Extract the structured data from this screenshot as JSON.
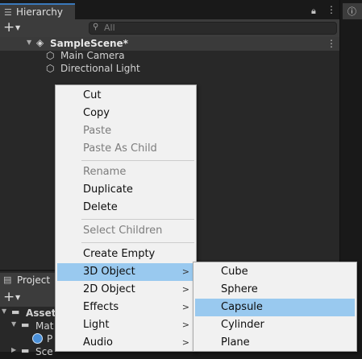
{
  "hierarchy": {
    "tab_icon": "hierarchy-list-icon",
    "tab_label": "Hierarchy",
    "search_placeholder": "All",
    "scene_name": "SampleScene*",
    "objects": [
      "Main Camera",
      "Directional Light"
    ]
  },
  "project": {
    "tab_label": "Project",
    "tree": [
      "Asset",
      "Mat",
      "P",
      "Sce"
    ]
  },
  "context_menu": {
    "items": [
      {
        "label": "Cut",
        "enabled": true
      },
      {
        "label": "Copy",
        "enabled": true
      },
      {
        "label": "Paste",
        "enabled": false
      },
      {
        "label": "Paste As Child",
        "enabled": false
      },
      {
        "label": "Rename",
        "enabled": false
      },
      {
        "label": "Duplicate",
        "enabled": true
      },
      {
        "label": "Delete",
        "enabled": true
      },
      {
        "label": "Select Children",
        "enabled": false
      },
      {
        "label": "Create Empty",
        "enabled": true
      },
      {
        "label": "3D Object",
        "enabled": true,
        "submenu": true,
        "highlighted": true
      },
      {
        "label": "2D Object",
        "enabled": true,
        "submenu": true
      },
      {
        "label": "Effects",
        "enabled": true,
        "submenu": true
      },
      {
        "label": "Light",
        "enabled": true,
        "submenu": true
      },
      {
        "label": "Audio",
        "enabled": true,
        "submenu": true
      }
    ]
  },
  "submenu_3d": {
    "items": [
      "Cube",
      "Sphere",
      "Capsule",
      "Cylinder",
      "Plane"
    ],
    "highlighted": "Capsule"
  },
  "colors": {
    "menu_highlight": "#99c9ef",
    "tab_accent": "#3a79bb",
    "panel_bg": "#282828"
  }
}
